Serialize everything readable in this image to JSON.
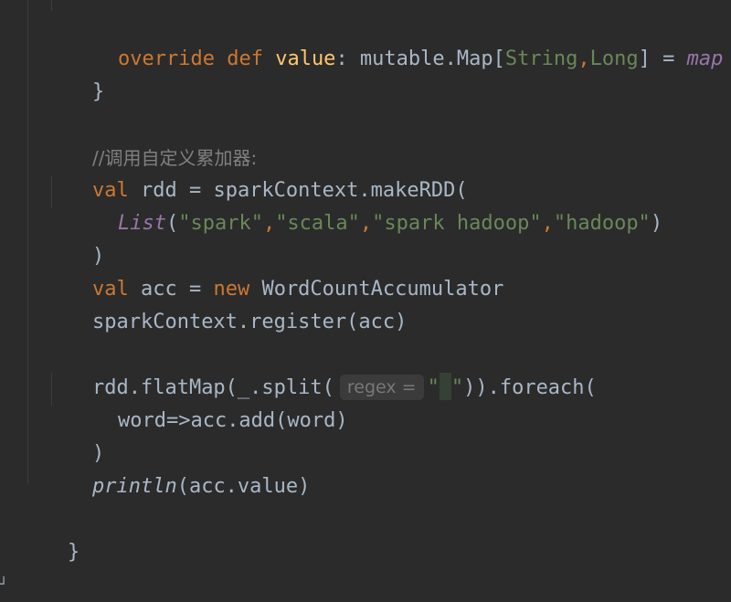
{
  "code": {
    "line1": {
      "kw_override": "override",
      "kw_def": "def",
      "name": "value",
      "colon": ": mutable.Map[",
      "type1": "String",
      "comma": ",",
      "type2": "Long",
      "close": "] = ",
      "value": "map"
    },
    "line2": {
      "text": "}"
    },
    "line3": {
      "comment": "//调用自定义累加器:"
    },
    "line4": {
      "kw": "val",
      "rest": " rdd = sparkContext.makeRDD("
    },
    "line5": {
      "fn": "List",
      "open": "(",
      "s1": "\"spark\"",
      "c1": ",",
      "s2": "\"scala\"",
      "c2": ",",
      "s3": "\"spark hadoop\"",
      "c3": ",",
      "s4": "\"hadoop\"",
      "close": ")"
    },
    "line6": {
      "text": ")"
    },
    "line7": {
      "kw_val": "val",
      "mid": " acc = ",
      "kw_new": "new",
      "rest": " WordCountAccumulator"
    },
    "line8": {
      "text": "sparkContext.register(acc)"
    },
    "line9": {
      "pre": "rdd.flatMap(_.split(",
      "hint": "regex =",
      "quote_open": "\"",
      "quote_close": "\"",
      "post": ")).foreach("
    },
    "line10": {
      "text": "word=>acc.add(word)"
    },
    "line11": {
      "text": ")"
    },
    "line12": {
      "fn": "println",
      "rest": "(acc.value)"
    },
    "line13": {
      "text": "}"
    }
  },
  "colors": {
    "background": "#2b2b2b",
    "keyword": "#cc7832",
    "string": "#6a8759",
    "function_decl": "#ffc66d",
    "italic_member": "#9876aa",
    "comment": "#808080",
    "default_text": "#a9b7c6"
  }
}
